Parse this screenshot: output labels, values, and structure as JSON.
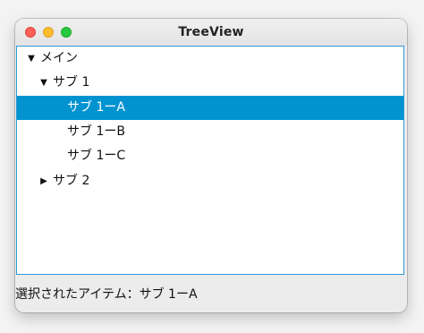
{
  "window": {
    "title": "TreeView"
  },
  "tree": {
    "items": [
      {
        "label": "メイン",
        "expanded": true,
        "level": 0,
        "selected": false,
        "arrow": "▼"
      },
      {
        "label": "サブ 1",
        "expanded": true,
        "level": 1,
        "selected": false,
        "arrow": "▼"
      },
      {
        "label": "サブ 1ーA",
        "level": 2,
        "selected": true
      },
      {
        "label": "サブ 1ーB",
        "level": 2,
        "selected": false
      },
      {
        "label": "サブ 1ーC",
        "level": 2,
        "selected": false
      },
      {
        "label": "サブ 2",
        "expanded": false,
        "level": 1,
        "selected": false,
        "arrow": "▶"
      }
    ]
  },
  "status": {
    "text": "選択されたアイテム：サブ 1ーA"
  },
  "colors": {
    "selection": "#0093d0",
    "focus_border": "#2a9ad6"
  }
}
